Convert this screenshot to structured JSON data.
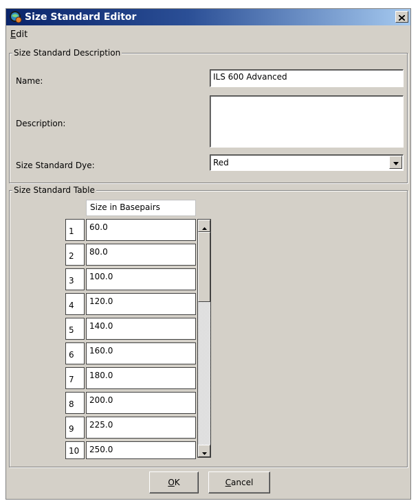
{
  "window": {
    "title": "Size Standard Editor"
  },
  "menu": {
    "edit_mnemonic": "E",
    "edit_rest": "dit"
  },
  "description_group": {
    "legend": "Size Standard Description",
    "name_label": "Name:",
    "name_value": "ILS 600 Advanced",
    "description_label": "Description:",
    "description_value": "",
    "dye_label": "Size Standard Dye:",
    "dye_value": "Red"
  },
  "table_group": {
    "legend": "Size Standard Table",
    "column_header": "Size in Basepairs",
    "rows": [
      {
        "num": "1",
        "value": "60.0"
      },
      {
        "num": "2",
        "value": "80.0"
      },
      {
        "num": "3",
        "value": "100.0"
      },
      {
        "num": "4",
        "value": "120.0"
      },
      {
        "num": "5",
        "value": "140.0"
      },
      {
        "num": "6",
        "value": "160.0"
      },
      {
        "num": "7",
        "value": "180.0"
      },
      {
        "num": "8",
        "value": "200.0"
      },
      {
        "num": "9",
        "value": "225.0"
      },
      {
        "num": "10",
        "value": "250.0"
      }
    ]
  },
  "buttons": {
    "ok_mnemonic": "O",
    "ok_rest": "K",
    "cancel_mnemonic": "C",
    "cancel_rest": "ancel"
  },
  "icons": {
    "app": "app-globe-icon",
    "close": "close-icon",
    "dropdown": "chevron-down-icon",
    "scroll_up": "scroll-up-arrow-icon",
    "scroll_down": "scroll-down-arrow-icon"
  },
  "colors": {
    "title_bar_start": "#0a246a",
    "title_bar_end": "#a6caf0",
    "window_bg": "#d4d0c8"
  }
}
